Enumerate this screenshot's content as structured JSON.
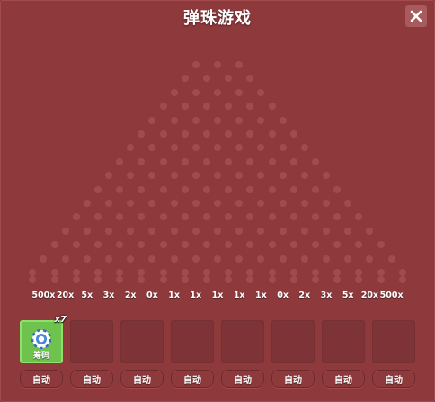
{
  "header": {
    "title": "弹珠游戏"
  },
  "close": {
    "icon": "close-icon"
  },
  "board": {
    "multipliers": [
      "500x",
      "20x",
      "5x",
      "3x",
      "2x",
      "0x",
      "1x",
      "1x",
      "1x",
      "1x",
      "1x",
      "0x",
      "2x",
      "3x",
      "5x",
      "20x",
      "500x"
    ]
  },
  "slots": [
    {
      "active": true,
      "label": "筹码",
      "count": "x7",
      "icon": "chip-icon"
    },
    {
      "active": false
    },
    {
      "active": false
    },
    {
      "active": false
    },
    {
      "active": false
    },
    {
      "active": false
    },
    {
      "active": false
    },
    {
      "active": false
    }
  ],
  "auto_buttons": [
    "自动",
    "自动",
    "自动",
    "自动",
    "自动",
    "自动",
    "自动",
    "自动"
  ],
  "colors": {
    "background": "#8e3a3c",
    "peg": "#a14b4d",
    "active_slot": "#6ec24e",
    "text": "#ffffff"
  }
}
